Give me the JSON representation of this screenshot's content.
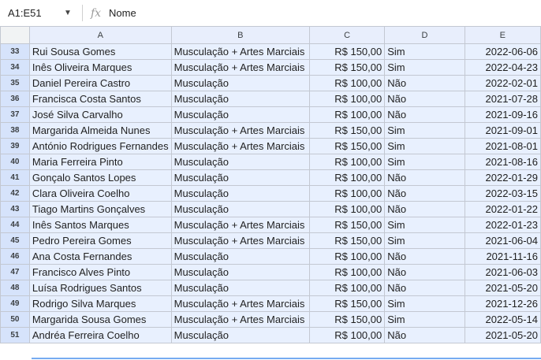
{
  "formula_bar": {
    "name_box": "A1:E51",
    "fx_label": "fx",
    "value": "Nome"
  },
  "columns": [
    "A",
    "B",
    "C",
    "D",
    "E"
  ],
  "rows": [
    {
      "num": "33",
      "a": "Rui Sousa Gomes",
      "b": "Musculação + Artes Marciais",
      "c": "R$ 150,00",
      "d": "Sim",
      "e": "2022-06-06"
    },
    {
      "num": "34",
      "a": "Inês Oliveira Marques",
      "b": "Musculação + Artes Marciais",
      "c": "R$ 150,00",
      "d": "Sim",
      "e": "2022-04-23"
    },
    {
      "num": "35",
      "a": "Daniel Pereira Castro",
      "b": "Musculação",
      "c": "R$ 100,00",
      "d": "Não",
      "e": "2022-02-01"
    },
    {
      "num": "36",
      "a": "Francisca Costa Santos",
      "b": "Musculação",
      "c": "R$ 100,00",
      "d": "Não",
      "e": "2021-07-28"
    },
    {
      "num": "37",
      "a": "José Silva Carvalho",
      "b": "Musculação",
      "c": "R$ 100,00",
      "d": "Não",
      "e": "2021-09-16"
    },
    {
      "num": "38",
      "a": "Margarida Almeida Nunes",
      "b": "Musculação + Artes Marciais",
      "c": "R$ 150,00",
      "d": "Sim",
      "e": "2021-09-01"
    },
    {
      "num": "39",
      "a": "António Rodrigues Fernandes",
      "b": "Musculação + Artes Marciais",
      "c": "R$ 150,00",
      "d": "Sim",
      "e": "2021-08-01"
    },
    {
      "num": "40",
      "a": "Maria Ferreira Pinto",
      "b": "Musculação",
      "c": "R$ 100,00",
      "d": "Sim",
      "e": "2021-08-16"
    },
    {
      "num": "41",
      "a": "Gonçalo Santos Lopes",
      "b": "Musculação",
      "c": "R$ 100,00",
      "d": "Não",
      "e": "2022-01-29"
    },
    {
      "num": "42",
      "a": "Clara Oliveira Coelho",
      "b": "Musculação",
      "c": "R$ 100,00",
      "d": "Não",
      "e": "2022-03-15"
    },
    {
      "num": "43",
      "a": "Tiago Martins Gonçalves",
      "b": "Musculação",
      "c": "R$ 100,00",
      "d": "Não",
      "e": "2022-01-22"
    },
    {
      "num": "44",
      "a": "Inês Santos Marques",
      "b": "Musculação + Artes Marciais",
      "c": "R$ 150,00",
      "d": "Sim",
      "e": "2022-01-23"
    },
    {
      "num": "45",
      "a": "Pedro Pereira Gomes",
      "b": "Musculação + Artes Marciais",
      "c": "R$ 150,00",
      "d": "Sim",
      "e": "2021-06-04"
    },
    {
      "num": "46",
      "a": "Ana Costa Fernandes",
      "b": "Musculação",
      "c": "R$ 100,00",
      "d": "Não",
      "e": "2021-11-16"
    },
    {
      "num": "47",
      "a": "Francisco Alves Pinto",
      "b": "Musculação",
      "c": "R$ 100,00",
      "d": "Não",
      "e": "2021-06-03"
    },
    {
      "num": "48",
      "a": "Luísa Rodrigues Santos",
      "b": "Musculação",
      "c": "R$ 100,00",
      "d": "Não",
      "e": "2021-05-20"
    },
    {
      "num": "49",
      "a": "Rodrigo Silva Marques",
      "b": "Musculação + Artes Marciais",
      "c": "R$ 150,00",
      "d": "Sim",
      "e": "2021-12-26"
    },
    {
      "num": "50",
      "a": "Margarida Sousa Gomes",
      "b": "Musculação + Artes Marciais",
      "c": "R$ 150,00",
      "d": "Sim",
      "e": "2022-05-14"
    },
    {
      "num": "51",
      "a": "Andréa Ferreira Coelho",
      "b": "Musculação",
      "c": "R$ 100,00",
      "d": "Não",
      "e": "2021-05-20"
    }
  ],
  "icons": {
    "name_box_dropdown": "chevron-down-icon",
    "function": "fx-icon"
  },
  "colors": {
    "selection_fill": "#e8f0fe",
    "selection_header": "#d6e3fb",
    "selection_border": "#1a73e8"
  }
}
